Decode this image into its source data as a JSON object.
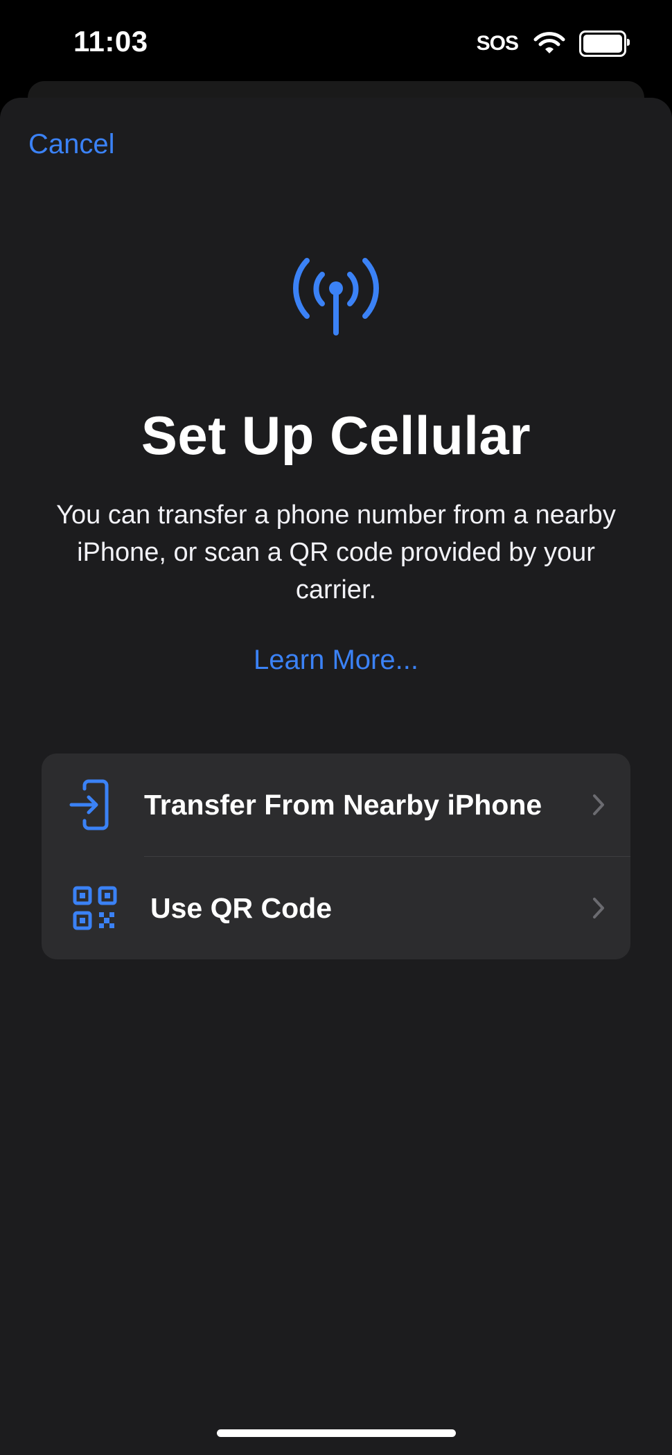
{
  "status_bar": {
    "time": "11:03",
    "signal_text": "SOS"
  },
  "header": {
    "cancel_label": "Cancel"
  },
  "main": {
    "icon": "antenna-icon",
    "title": "Set Up Cellular",
    "description": "You can transfer a phone number from a nearby iPhone, or scan a QR code provided by your carrier.",
    "learn_more_label": "Learn More..."
  },
  "options": [
    {
      "label": "Transfer From Nearby iPhone",
      "icon": "phone-transfer-icon"
    },
    {
      "label": "Use QR Code",
      "icon": "qr-code-icon"
    }
  ],
  "colors": {
    "accent": "#3b82f6",
    "sheet_background": "#1c1c1e",
    "card_background": "#2c2c2e"
  }
}
